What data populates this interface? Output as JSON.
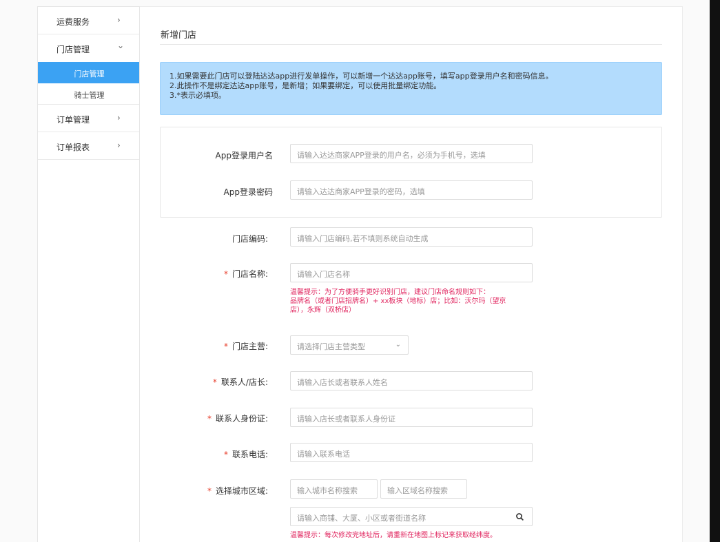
{
  "sidebar": {
    "items": [
      {
        "label": "运费服务",
        "chevron": "›"
      },
      {
        "label": "门店管理",
        "chevron": "⌄"
      },
      {
        "label": "订单管理",
        "chevron": "›"
      },
      {
        "label": "订单报表",
        "chevron": "›"
      }
    ],
    "sub_items": [
      {
        "label": "门店管理",
        "active": true
      },
      {
        "label": "骑士管理",
        "active": false
      }
    ]
  },
  "page": {
    "title": "新增门店",
    "notice": [
      "1.如果需要此门店可以登陆达达app进行发单操作，可以新增一个达达app账号，填写app登录用户名和密码信息。",
      "2.此操作不是绑定达达app账号，是新增；如果要绑定，可以使用批量绑定功能。",
      "3.*表示必填项。"
    ]
  },
  "form": {
    "app_username": {
      "label": "App登录用户名",
      "placeholder": "请输入达达商家APP登录的用户名，必须为手机号，选填"
    },
    "app_password": {
      "label": "App登录密码",
      "placeholder": "请输入达达商家APP登录的密码，选填"
    },
    "store_code": {
      "label": "门店编码:",
      "placeholder": "请输入门店编码,若不填则系统自动生成"
    },
    "store_name": {
      "label": "门店名称:",
      "required": "*",
      "placeholder": "请输入门店名称"
    },
    "store_name_hint": [
      "温馨提示：为了方便骑手更好识别门店，建议门店命名规则如下：",
      "品牌名（或者门店招牌名）+ xx板块（地标）店；比如：沃尔玛（望京",
      "店），永辉（双桥店）"
    ],
    "store_category": {
      "label": "门店主营:",
      "required": "*",
      "placeholder": "请选择门店主营类型",
      "arrow": "⌄"
    },
    "contact_name": {
      "label": "联系人/店长:",
      "required": "*",
      "placeholder": "请输入店长或者联系人姓名"
    },
    "contact_id": {
      "label": "联系人身份证:",
      "required": "*",
      "placeholder": "请输入店长或者联系人身份证"
    },
    "contact_phone": {
      "label": "联系电话:",
      "required": "*",
      "placeholder": "请输入联系电话"
    },
    "city_area": {
      "label": "选择城市区域:",
      "required": "*",
      "city_placeholder": "输入城市名称搜索",
      "area_placeholder": "输入区域名称搜索"
    },
    "address": {
      "placeholder": "请输入商铺、大厦、小区或者街道名称"
    },
    "address_hint": "温馨提示：每次修改完地址后，请重新在地图上标记来获取经纬度。"
  },
  "colors": {
    "active_nav": "#3ba2f3",
    "notice_bg": "#b3dcfd",
    "required_star": "#e8412f",
    "hint_text": "#e0245e"
  },
  "icons": {
    "search": "search-icon"
  }
}
